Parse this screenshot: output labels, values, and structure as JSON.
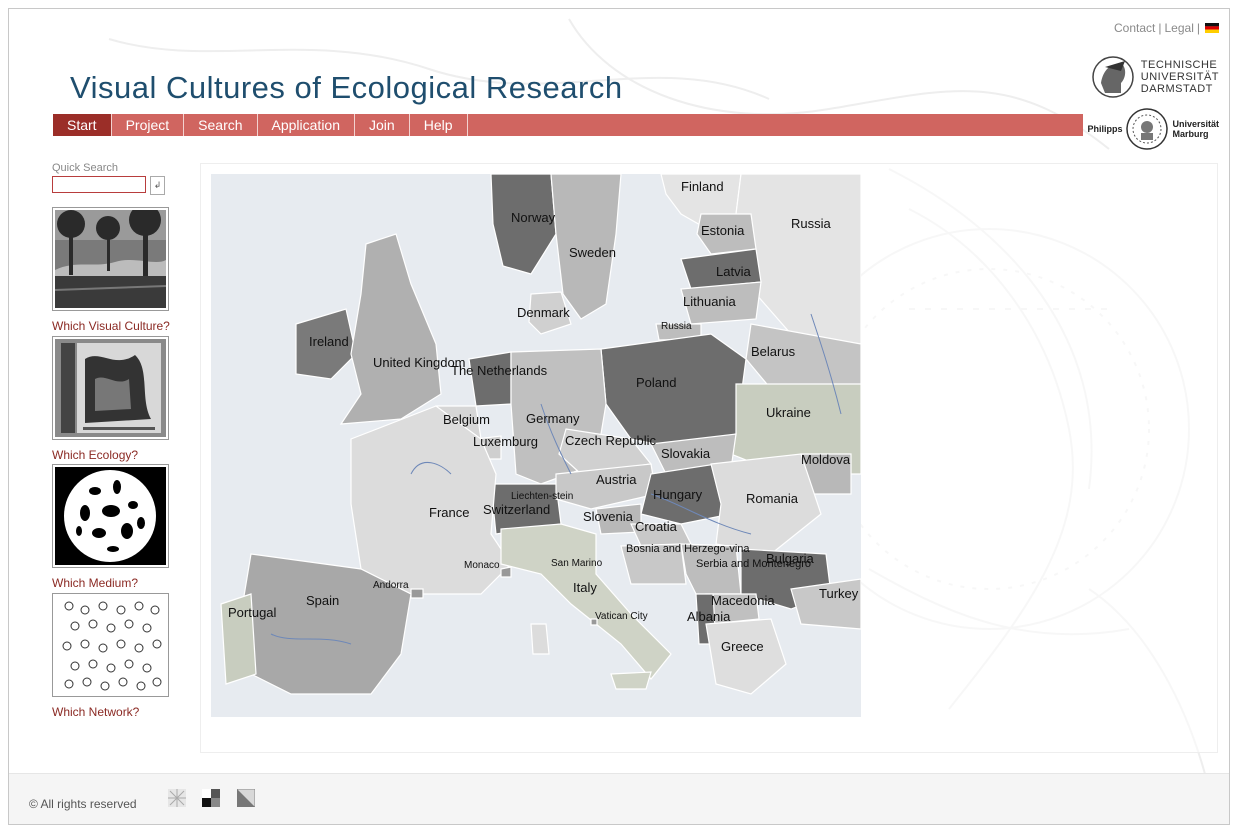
{
  "header": {
    "contact": "Contact",
    "legal": "Legal",
    "title": "Visual Cultures of Ecological Research",
    "tud_lines": [
      "TECHNISCHE",
      "UNIVERSITÄT",
      "DARMSTADT"
    ],
    "umr_left": "Philipps",
    "umr_right": [
      "Universität",
      "Marburg"
    ]
  },
  "nav": {
    "items": [
      {
        "label": "Start",
        "active": true
      },
      {
        "label": "Project"
      },
      {
        "label": "Search"
      },
      {
        "label": "Application"
      },
      {
        "label": "Join"
      },
      {
        "label": "Help"
      }
    ]
  },
  "sidebar": {
    "quick_search_label": "Quick Search",
    "quick_search_value": "",
    "search_button_icon": "enter-icon",
    "thumbs": [
      {
        "caption": "Which Visual Culture?",
        "icon": "forest-engraving-image"
      },
      {
        "caption": "Which Ecology?",
        "icon": "book-cover-image"
      },
      {
        "caption": "Which Medium?",
        "icon": "microscope-image"
      },
      {
        "caption": "Which Network?",
        "icon": "network-portraits-image"
      }
    ]
  },
  "map": {
    "countries": [
      "Norway",
      "Sweden",
      "Finland",
      "Russia",
      "Estonia",
      "Latvia",
      "Lithuania",
      "Russia",
      "Denmark",
      "Ireland",
      "United Kingdom",
      "The Netherlands",
      "Belarus",
      "Poland",
      "Germany",
      "Belgium",
      "Luxemburg",
      "Czech Republic",
      "Ukraine",
      "Slovakia",
      "Moldova",
      "Liechten-stein",
      "Switzerland",
      "Austria",
      "Hungary",
      "France",
      "Romania",
      "Slovenia",
      "Croatia",
      "Bosnia and Herzego-vina",
      "Serbia and Montenegro",
      "Bulgaria",
      "Monaco",
      "San Marino",
      "Andorra",
      "Italy",
      "Spain",
      "Portugal",
      "Macedonia",
      "Albania",
      "Turkey",
      "Vatican City",
      "Greece"
    ]
  },
  "footer": {
    "copyright": "© All rights reserved",
    "icons": [
      "pattern-icon",
      "contrast-squares-icon",
      "diagonal-contrast-icon"
    ]
  },
  "colors": {
    "title": "#1f4e6e",
    "nav": "#d06560",
    "nav_active": "#9b2e28",
    "link": "#8b2a24",
    "sea": "#e7ebf0"
  }
}
